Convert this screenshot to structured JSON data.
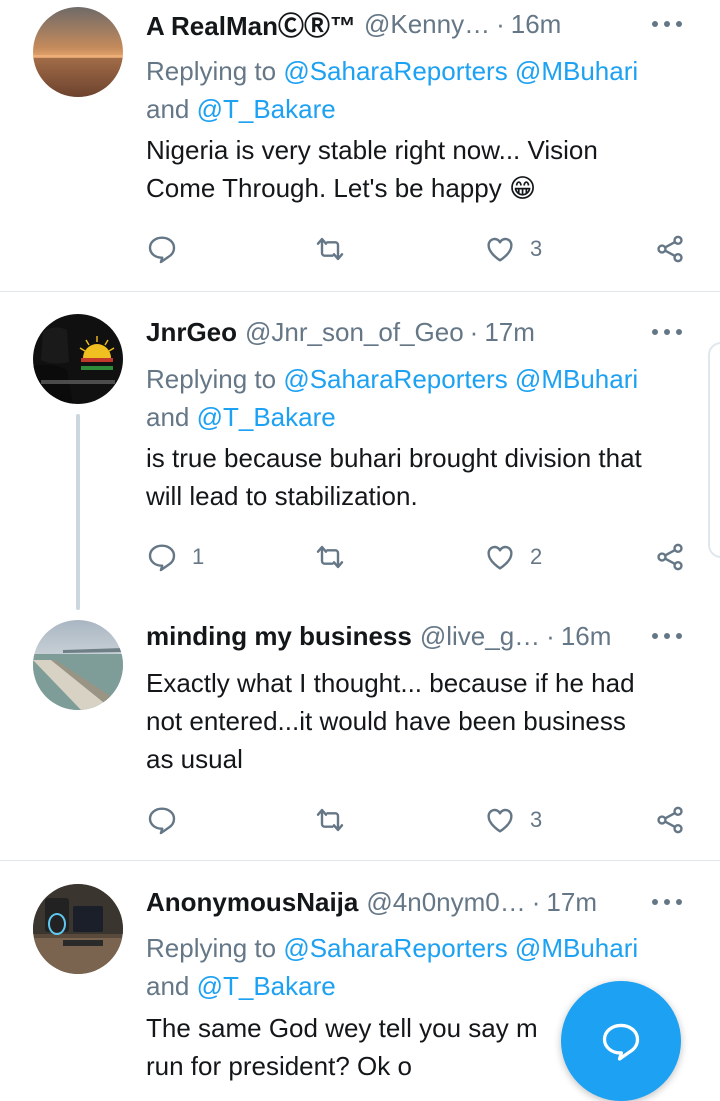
{
  "tweets": [
    {
      "name": "A RealManⒸⓇ™",
      "handle": "@Kenny…",
      "time": "16m",
      "replying_prefix": "Replying to ",
      "replying_mentions": "@SaharaReporters @MBuhari",
      "replying_and": "and ",
      "replying_last": "@T_Bakare",
      "text_line1": "Nigeria is very stable right now... Vision",
      "text_line2": "Come Through. Let's be happy",
      "emoji": "😁",
      "replies": "",
      "likes": "3"
    },
    {
      "name": "JnrGeo",
      "handle": "@Jnr_son_of_Geo",
      "time": "17m",
      "replying_prefix": "Replying to ",
      "replying_mentions": "@SaharaReporters @MBuhari",
      "replying_and": "and ",
      "replying_last": "@T_Bakare",
      "text_line1": "is true because buhari brought division that",
      "text_line2": "will lead to stabilization.",
      "replies": "1",
      "likes": "2"
    },
    {
      "name": "minding my business",
      "handle": "@live_g…",
      "time": "16m",
      "text_line1": "Exactly what I thought... because if he had",
      "text_line2": "not entered...it would have been business",
      "text_line3": "as usual",
      "replies": "",
      "likes": "3"
    },
    {
      "name": "AnonymousNaija",
      "handle": "@4n0nym0…",
      "time": "17m",
      "replying_prefix": "Replying to ",
      "replying_mentions": "@SaharaReporters @MBuhari",
      "replying_and": "and ",
      "replying_last": "@T_Bakare",
      "text_line1": "The same God wey tell you say m",
      "text_line2": "run for president? Ok o"
    }
  ],
  "separator": "·",
  "colors": {
    "accent": "#1da1f2",
    "secondary_text": "#657786",
    "divider": "#e1e8ed"
  },
  "icons": [
    "reply-icon",
    "retweet-icon",
    "like-icon",
    "share-icon",
    "more-icon",
    "compose-reply-icon"
  ]
}
